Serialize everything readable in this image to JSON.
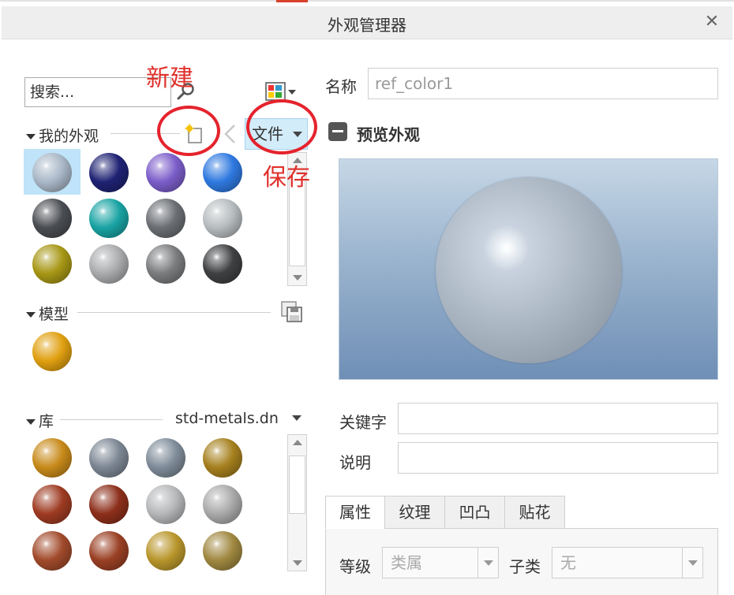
{
  "window": {
    "title": "外观管理器",
    "close_symbol": "✕"
  },
  "left": {
    "search": {
      "value": "搜索..."
    },
    "my_appearances": {
      "header": "我的外观",
      "file_button": "文件",
      "swatches": [
        {
          "name": "ref_color1",
          "color": "#a9b7c7",
          "selected": true
        },
        {
          "color": "#1f2273"
        },
        {
          "color": "#7b5dc9"
        },
        {
          "color": "#2f79e0"
        },
        {
          "color": "#4a4d52"
        },
        {
          "color": "#1aa3a3"
        },
        {
          "color": "#6b6e73"
        },
        {
          "color": "#b7bcbf"
        },
        {
          "color": "#a79715"
        },
        {
          "color": "#a9abad"
        },
        {
          "color": "#7a7c7e"
        },
        {
          "color": "#3e4042"
        }
      ]
    },
    "model": {
      "header": "模型",
      "swatches": [
        {
          "color": "#e0a010"
        }
      ]
    },
    "library": {
      "header": "库",
      "file": "std-metals.dn",
      "swatches": [
        {
          "color": "#c88a1a"
        },
        {
          "color": "#7c8794"
        },
        {
          "color": "#7f8c99"
        },
        {
          "color": "#a6801e"
        },
        {
          "color": "#9e3b22"
        },
        {
          "color": "#8d2f1b"
        },
        {
          "color": "#b5b7b9"
        },
        {
          "color": "#aaaaaa"
        },
        {
          "color": "#a14a2b"
        },
        {
          "color": "#9a4024"
        },
        {
          "color": "#b9962c"
        },
        {
          "color": "#a08840"
        }
      ]
    }
  },
  "annotations": {
    "new_label": "新建",
    "save_label": "保存"
  },
  "right": {
    "name_label": "名称",
    "name_value": "ref_color1",
    "preview_title": "预览外观",
    "keywords_label": "关键字",
    "description_label": "说明",
    "tabs": [
      "属性",
      "纹理",
      "凹凸",
      "贴花"
    ],
    "level_label": "等级",
    "level_value": "类属",
    "subclass_label": "子类",
    "subclass_value": "无"
  }
}
